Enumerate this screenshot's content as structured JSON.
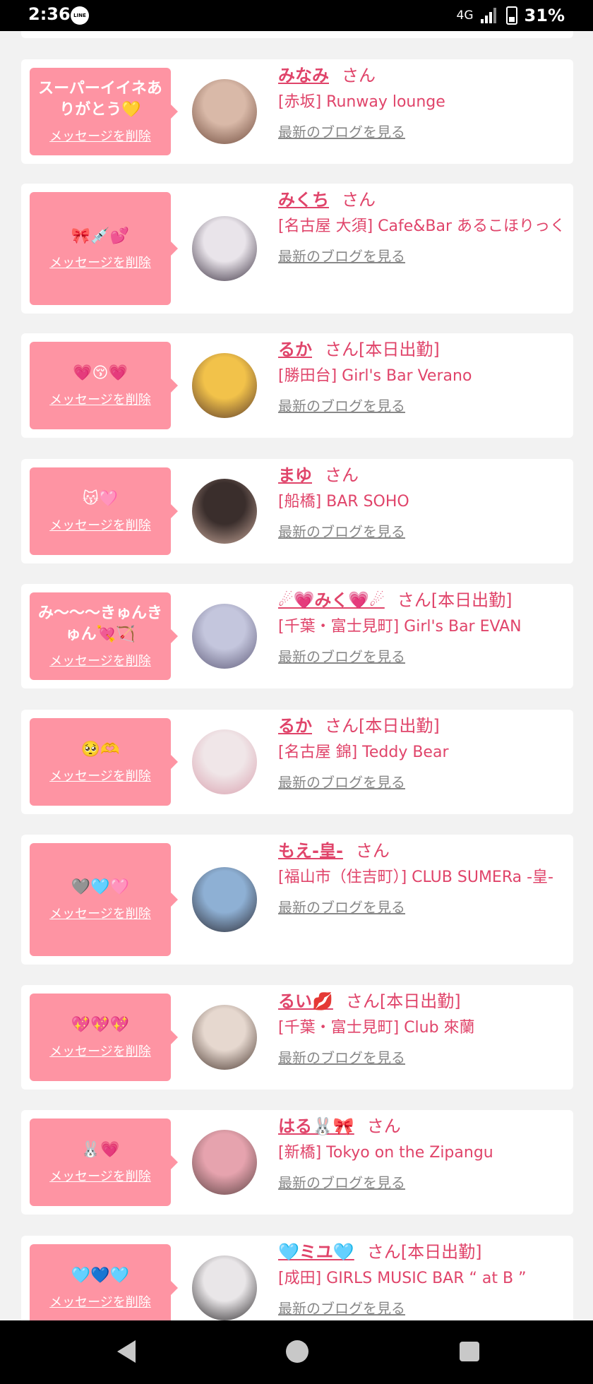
{
  "status_bar": {
    "time": "2:36",
    "line_label": "LINE",
    "network": "4G",
    "battery": "31%"
  },
  "labels": {
    "delete": "メッセージを削除",
    "blog": "最新のブログを見る",
    "san": "さん"
  },
  "cards": [
    {
      "message": "スーパーイイネありがとう💛",
      "name": "みなみ",
      "suffix": "",
      "shop": "[赤坂] Runway lounge",
      "avatar_colors": [
        "#d9b9a8",
        "#6e4a3c"
      ]
    },
    {
      "message": "🎀💉💕",
      "name": "みくち",
      "suffix": "",
      "shop": "[名古屋 大須] Cafe&Bar あるこほりっく",
      "avatar_colors": [
        "#e9e4ea",
        "#3a3040"
      ]
    },
    {
      "message": "💗😚💗",
      "name": "るか",
      "suffix": "[本日出勤]",
      "shop": "[勝田台] Girl's Bar Verano",
      "avatar_colors": [
        "#f2c24a",
        "#5a3a2a"
      ]
    },
    {
      "message": "😽🩷",
      "name": "まゆ",
      "suffix": "",
      "shop": "[船橋] BAR SOHO",
      "avatar_colors": [
        "#3a2e2c",
        "#c8a89a"
      ]
    },
    {
      "message": "み〜〜〜きゅんきゅん💘🏹",
      "name": "☄💗みく💗☄",
      "suffix": "[本日出勤]",
      "shop": "[千葉・富士見町] Girl's Bar EVAN",
      "avatar_colors": [
        "#c4c6dd",
        "#5e5a78"
      ]
    },
    {
      "message": "🥺🫶",
      "name": "るか",
      "suffix": "[本日出勤]",
      "shop": "[名古屋 錦] Teddy Bear",
      "avatar_colors": [
        "#f0e6e8",
        "#d9a0ae"
      ]
    },
    {
      "message": "🩶🩵🩷",
      "name": "もえ-皇-",
      "suffix": "",
      "shop": "[福山市（住吉町）] CLUB SUMERa -皇-",
      "avatar_colors": [
        "#8eb0d4",
        "#2b2a33"
      ]
    },
    {
      "message": "💖💖💖",
      "name": "るい💋",
      "suffix": "[本日出勤]",
      "shop": "[千葉・富士見町] Club 來蘭",
      "avatar_colors": [
        "#e6d8cf",
        "#4a3830"
      ]
    },
    {
      "message": "🐰💗",
      "name": "はる🐰🎀",
      "suffix": "",
      "shop": "[新橋] Tokyo on the Zipangu",
      "avatar_colors": [
        "#e6a3ae",
        "#5b4242"
      ]
    },
    {
      "message": "🩵💙🩵",
      "name": "🩵ミユ🩵",
      "suffix": "[本日出勤]",
      "shop": "[成田] GIRLS MUSIC BAR “ at B ”",
      "avatar_colors": [
        "#e9e6e8",
        "#2d2a2c"
      ]
    }
  ]
}
